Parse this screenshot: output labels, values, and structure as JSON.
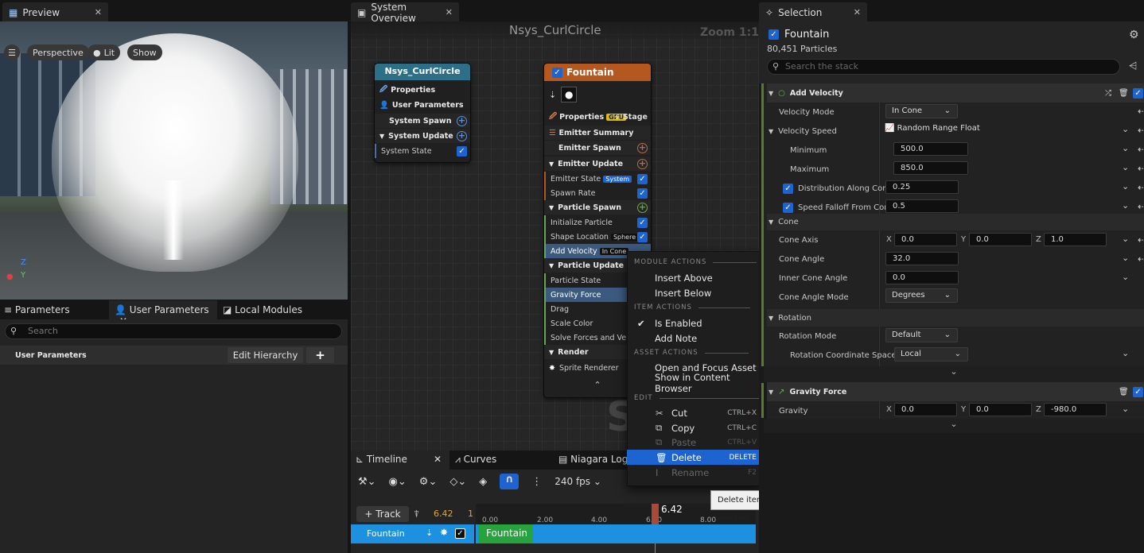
{
  "preview": {
    "tab": "Preview",
    "perspective": "Perspective",
    "lit": "Lit",
    "show": "Show"
  },
  "overview": {
    "tab": "System Overview",
    "system_name": "Nsys_CurlCircle",
    "zoom": "Zoom 1:1",
    "watermark": "S"
  },
  "selection": {
    "tab": "Selection",
    "emitter": "Fountain",
    "particles": "80,451 Particles",
    "search_placeholder": "Search the stack"
  },
  "params": {
    "tabs": [
      "Parameters",
      "User Parameters",
      "Local Modules"
    ],
    "search_placeholder": "Search",
    "section": "User Parameters",
    "edit_hierarchy": "Edit Hierarchy",
    "add": "+"
  },
  "system_node": {
    "title": "Nsys_CurlCircle",
    "rows": [
      "Properties",
      "User Parameters",
      "System Spawn",
      "System Update",
      "System State"
    ]
  },
  "emitter_node": {
    "title": "Fountain",
    "properties": "Properties",
    "gpu": "GPU",
    "stage": "+ Stage",
    "rows": [
      "Emitter Summary",
      "Emitter Spawn",
      "Emitter Update",
      "Emitter State",
      "Spawn Rate",
      "Particle Spawn",
      "Initialize Particle",
      "Shape Location",
      "Add Velocity",
      "Particle Update",
      "Particle State",
      "Gravity Force",
      "Drag",
      "Scale Color",
      "Solve Forces and Veloci",
      "Render",
      "Sprite Renderer"
    ],
    "tags": {
      "emitter_state": "System",
      "shape_location": "Sphere",
      "add_velocity": "In Cone"
    }
  },
  "context_menu": {
    "module_actions": "MODULE ACTIONS",
    "insert_above": "Insert Above",
    "insert_below": "Insert Below",
    "item_actions": "ITEM ACTIONS",
    "is_enabled": "Is Enabled",
    "add_note": "Add Note",
    "asset_actions": "ASSET ACTIONS",
    "open_focus": "Open and Focus Asset",
    "show_browser": "Show in Content Browser",
    "edit": "EDIT",
    "cut": "Cut",
    "cut_sc": "CTRL+X",
    "copy": "Copy",
    "copy_sc": "CTRL+C",
    "paste": "Paste",
    "paste_sc": "CTRL+V",
    "delete": "Delete",
    "delete_sc": "DELETE",
    "rename": "Rename",
    "rename_sc": "F2"
  },
  "tooltip": "Delete items in the selection which can be deleted.",
  "timeline": {
    "tab": "Timeline",
    "curves": "Curves",
    "log": "Niagara Log",
    "fps": "240 fps",
    "track": "+ Track",
    "time": "6.42",
    "one": "1",
    "ticks": [
      "0.00",
      "2.00",
      "4.00",
      "6.00",
      "8.00"
    ],
    "playhead": "6.42",
    "row_label": "Fountain",
    "clip": "Fountain"
  },
  "stack": {
    "add_velocity": "Add Velocity",
    "velocity_mode": "Velocity Mode",
    "velocity_mode_val": "In Cone",
    "velocity_speed": "Velocity Speed",
    "velocity_speed_val": "Random Range Float",
    "minimum": "Minimum",
    "minimum_val": "500.0",
    "maximum": "Maximum",
    "maximum_val": "850.0",
    "dist": "Distribution Along Cone A",
    "dist_val": "0.25",
    "falloff": "Speed Falloff From Cone",
    "falloff_val": "0.5",
    "cone": "Cone",
    "cone_axis": "Cone Axis",
    "axis_x": "0.0",
    "axis_y": "0.0",
    "axis_z": "1.0",
    "cone_angle": "Cone Angle",
    "cone_angle_val": "32.0",
    "inner_angle": "Inner Cone Angle",
    "inner_angle_val": "0.0",
    "angle_mode": "Cone Angle Mode",
    "angle_mode_val": "Degrees",
    "rotation": "Rotation",
    "rot_mode": "Rotation Mode",
    "rot_mode_val": "Default",
    "rot_space": "Rotation Coordinate Space",
    "rot_space_val": "Local",
    "gravity_force": "Gravity Force",
    "gravity": "Gravity",
    "g_x": "0.0",
    "g_y": "0.0",
    "g_z": "-980.0",
    "x": "X",
    "y": "Y",
    "z": "Z"
  },
  "colors": {
    "accent": "#1d64d0",
    "emitter_header": "#b5581f",
    "system_header": "#2d6f86",
    "timeline_bar": "#1e90e0",
    "clip": "#27a33e"
  }
}
